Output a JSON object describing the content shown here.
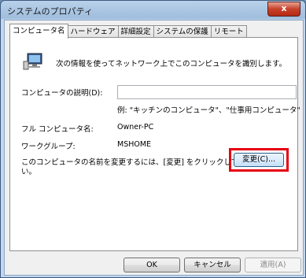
{
  "window": {
    "title": "システムのプロパティ",
    "close_label": "x"
  },
  "tabs": [
    {
      "label": "コンピュータ名"
    },
    {
      "label": "ハードウェア"
    },
    {
      "label": "詳細設定"
    },
    {
      "label": "システムの保護"
    },
    {
      "label": "リモート"
    }
  ],
  "panel": {
    "intro": "次の情報を使ってネットワーク上でこのコンピュータを識別します。",
    "description_label": "コンピュータの説明(D):",
    "description_value": "",
    "example": "例: \"キッチンのコンピュータ\"、\"仕事用コンピュータ\"",
    "full_name_label": "フル コンピュータ名:",
    "full_name_value": "Owner-PC",
    "workgroup_label": "ワークグループ:",
    "workgroup_value": "MSHOME",
    "rename_text_line1": "このコンピュータの名前を変更するには、[変更] をクリックしてくださ",
    "rename_text_line2": "い。",
    "change_button": "変更(C)..."
  },
  "buttons": {
    "ok": "OK",
    "cancel": "キャンセル",
    "apply": "適用(A)"
  },
  "colors": {
    "highlight": "#e60012"
  }
}
